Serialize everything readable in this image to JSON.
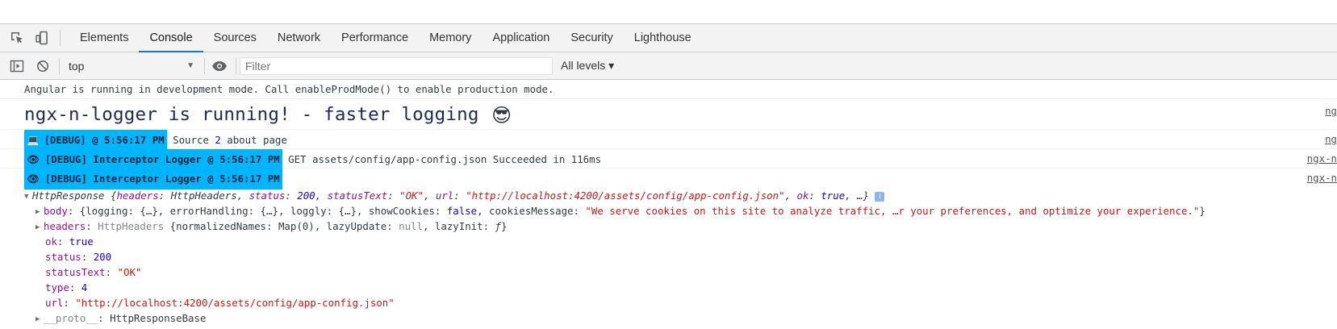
{
  "devtools": {
    "tabs": [
      "Elements",
      "Console",
      "Sources",
      "Network",
      "Performance",
      "Memory",
      "Application",
      "Security",
      "Lighthouse"
    ],
    "active_tab": "Console"
  },
  "toolbar": {
    "context": "top",
    "filter_placeholder": "Filter",
    "levels": "All levels ▾"
  },
  "console": {
    "msg1": "Angular is running in development mode. Call enableProdMode() to enable production mode.",
    "msg2": "ngx-n-logger is running! - faster logging",
    "msg2_emoji": "😎",
    "msg2_src": "ng",
    "msg3_badge": "[DEBUG] @ 5:56:17 PM",
    "msg3_text_a": "Source ",
    "msg3_num": "2",
    "msg3_text_b": " about page",
    "msg3_src": "ng",
    "msg4_badge": "[DEBUG] Interceptor Logger @ 5:56:17 PM",
    "msg4_text": "GET assets/config/app-config.json Succeeded in 116ms",
    "msg4_src": "ngx-n",
    "msg5_badge": "[DEBUG] Interceptor Logger @ 5:56:17 PM",
    "msg5_src": "ngx-n"
  },
  "obj": {
    "type_name": "HttpResponse",
    "l0_a": " {",
    "headers_key": "headers",
    "headers_val": "HttpHeaders",
    "status_key": "status",
    "status_val": "200",
    "statusText_key": "statusText",
    "statusText_val": "\"OK\"",
    "url_key": "url",
    "url_val": "\"http://localhost:4200/assets/config/app-config.json\"",
    "ok_key": "ok",
    "ok_val": "true",
    "trail": ", …}",
    "body_key": "body",
    "body_val_a": "{logging: {…}, errorHandling: {…}, loggly: {…}, showCookies: ",
    "body_false": "false",
    "body_val_b": ", cookiesMessage: ",
    "body_msg": "\"We serve cookies on this site to analyze traffic, …r your preferences, and optimize your experience.\"",
    "body_end": "}",
    "hdr_key": "headers",
    "hdr_type": "HttpHeaders",
    "hdr_a": " {normalizedNames: Map(0), lazyUpdate: ",
    "hdr_null": "null",
    "hdr_b": ", lazyInit: ",
    "hdr_f": "ƒ",
    "hdr_end": "}",
    "p_ok_key": "ok",
    "p_ok_val": "true",
    "p_status_key": "status",
    "p_status_val": "200",
    "p_statusText_key": "statusText",
    "p_statusText_val": "\"OK\"",
    "p_type_key": "type",
    "p_type_val": "4",
    "p_url_key": "url",
    "p_url_val": "\"http://localhost:4200/assets/config/app-config.json\"",
    "proto_key": "__proto__",
    "proto_val": "HttpResponseBase"
  }
}
